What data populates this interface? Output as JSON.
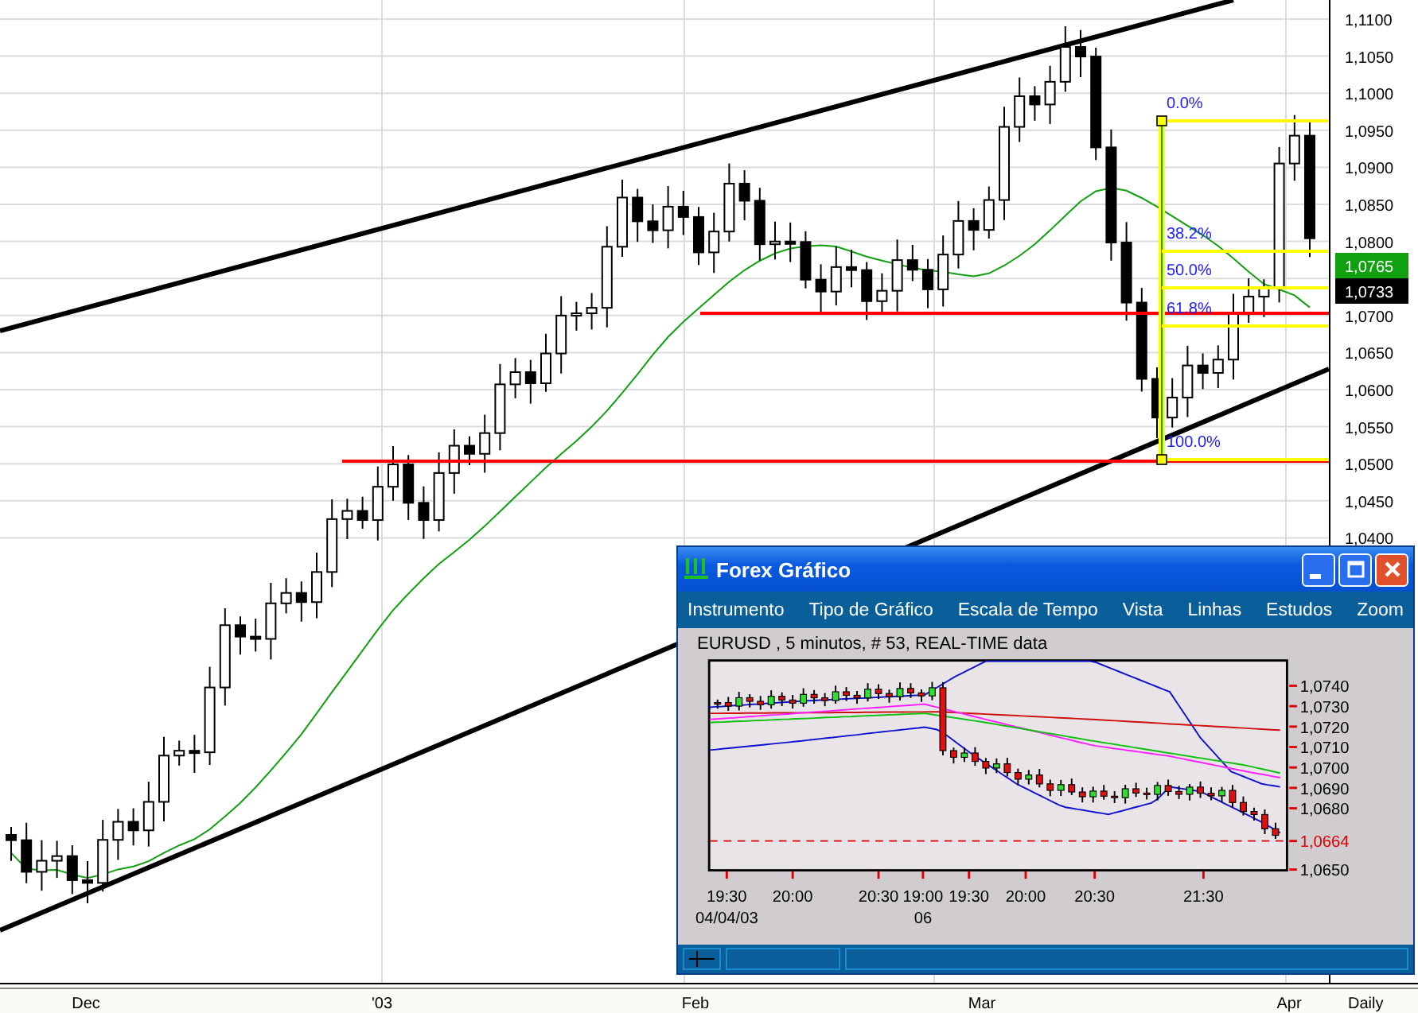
{
  "main_chart": {
    "y_axis_labels": [
      "1,1100",
      "1,1050",
      "1,1000",
      "1,0950",
      "1,0900",
      "1,0850",
      "1,0800",
      "1,0700",
      "1,0650",
      "1,0600",
      "1,0550",
      "1,0500",
      "1,0450",
      "1,0400"
    ],
    "price_tags": [
      {
        "label": "1,0765",
        "color": "#10a010"
      },
      {
        "label": "1,0733",
        "color": "#000000"
      }
    ],
    "fibonacci_levels": [
      "0.0%",
      "38.2%",
      "50.0%",
      "61.8%",
      "100.0%"
    ],
    "x_axis_labels": [
      "Dec",
      "'03",
      "Feb",
      "Mar",
      "Apr"
    ],
    "timeframe": "Daily"
  },
  "window": {
    "title": "Forex Gráfico",
    "menu": [
      "Instrumento",
      "Tipo de Gráfico",
      "Escala de Tempo",
      "Vista",
      "Linhas",
      "Estudos",
      "Zoom"
    ],
    "chart_title": "EURUSD , 5 minutos, # 53, REAL-TIME data",
    "y_axis_labels": [
      "1,0740",
      "1,0730",
      "1,0720",
      "1,0710",
      "1,0700",
      "1,0690",
      "1,0680",
      "1,0650"
    ],
    "last_price_label": "1,0664",
    "x_axis_labels": [
      {
        "time": "19:30",
        "date": "04/04/03"
      },
      {
        "time": "20:00"
      },
      {
        "time": "20:30"
      },
      {
        "time": "19:00",
        "date": "06"
      },
      {
        "time": "19:30"
      },
      {
        "time": "20:00"
      },
      {
        "time": "20:30"
      },
      {
        "time": "21:30"
      }
    ]
  }
}
